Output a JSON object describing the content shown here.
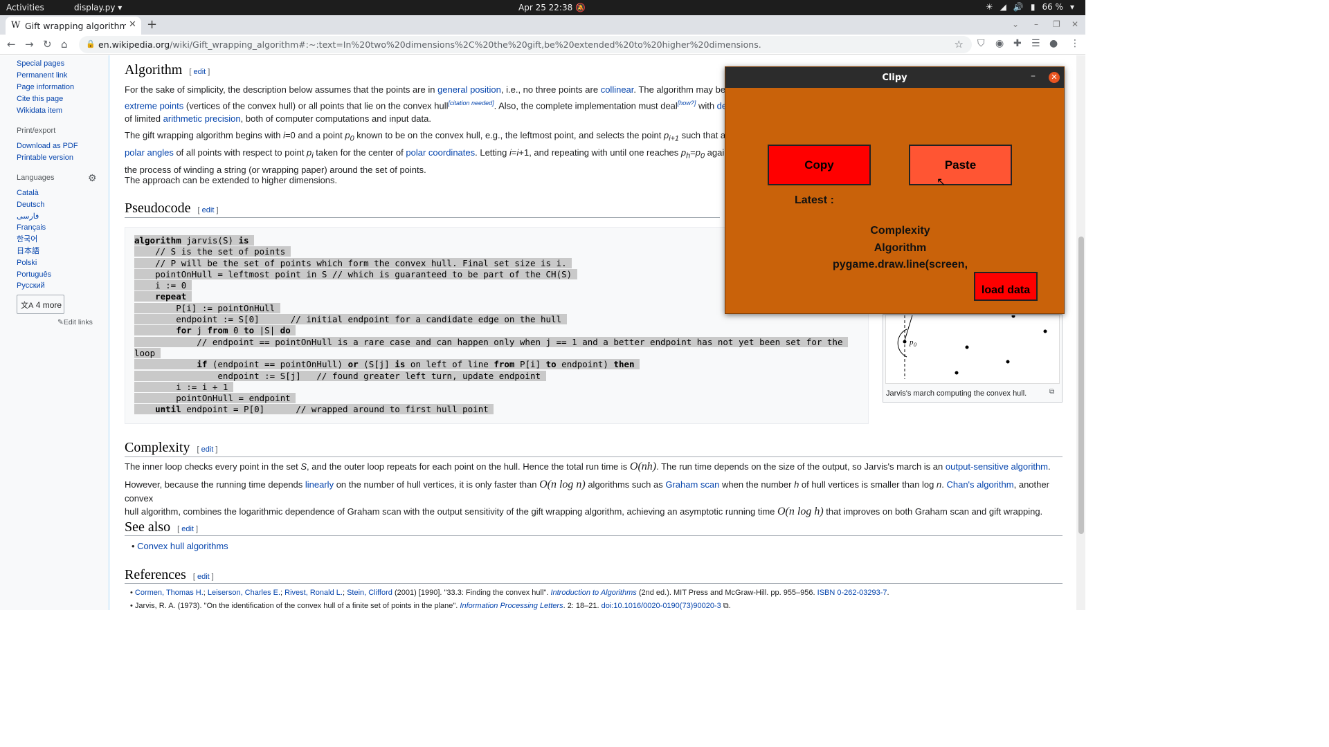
{
  "topbar": {
    "activities": "Activities",
    "app_menu": "display.py",
    "clock": "Apr 25  22:38",
    "battery": "66 %"
  },
  "browser": {
    "tab_title": "Gift wrapping algorithm",
    "url_host": "en.wikipedia.org",
    "url_path": "/wiki/Gift_wrapping_algorithm#:~:text=In%20two%20dimensions%2C%20the%20gift,be%20extended%20to%20higher%20dimensions."
  },
  "sidebar": {
    "tools": [
      "Special pages",
      "Permanent link",
      "Page information",
      "Cite this page",
      "Wikidata item"
    ],
    "print_heading": "Print/export",
    "print": [
      "Download as PDF",
      "Printable version"
    ],
    "languages_heading": "Languages",
    "languages": [
      "Català",
      "Deutsch",
      "فارسی",
      "Français",
      "한국어",
      "日本語",
      "Polski",
      "Português",
      "Русский"
    ],
    "more_languages": "4 more",
    "edit_links": "Edit links"
  },
  "article": {
    "edit_label": "edit",
    "algorithm": {
      "heading": "Algorithm",
      "p1_a": "For the sake of simplicity, the description below assumes that the points are in ",
      "p1_link1": "general position",
      "p1_b": ", i.e., no three points are ",
      "p1_link2": "collinear",
      "p1_c": ". The algorithm may be easi",
      "p1_link3": "extreme points",
      "p1_d": " (vertices of the convex hull) or all points that lie on the convex hull",
      "p1_sup1": "[citation needed]",
      "p1_e": ". Also, the complete implementation must deal",
      "p1_sup2": "[how?]",
      "p1_f": " with ",
      "p1_link4": "dege",
      "p1_g": "of limited ",
      "p1_link5": "arithmetic precision",
      "p1_h": ", both of computer computations and input data.",
      "p2_a": "The gift wrapping algorithm begins with ",
      "p2_b": "=0 and a point ",
      "p2_c": " known to be on the convex hull, e.g., the leftmost point, and selects the point ",
      "p2_d": " such that all poi",
      "p2_link1": "polar angles",
      "p2_e": " of all points with respect to point ",
      "p2_f": " taken for the center of ",
      "p2_link2": "polar coordinates",
      "p2_g": ". Letting ",
      "p2_h": "=",
      "p2_i": "+1, and repeating with until one reaches ",
      "p2_j": " again yiel",
      "p2_k": "the process of winding a string (or wrapping paper) around the set of points.",
      "p3": "The approach can be extended to higher dimensions."
    },
    "pseudocode": {
      "heading": "Pseudocode",
      "lines": [
        "algorithm jarvis(S) is",
        "    // S is the set of points",
        "    // P will be the set of points which form the convex hull. Final set size is i.",
        "    pointOnHull = leftmost point in S // which is guaranteed to be part of the CH(S)",
        "    i := 0",
        "    repeat",
        "        P[i] := pointOnHull",
        "        endpoint := S[0]      // initial endpoint for a candidate edge on the hull",
        "        for j from 0 to |S| do",
        "            // endpoint == pointOnHull is a rare case and can happen only when j == 1 and a better endpoint has not yet been set for the",
        "loop",
        "            if (endpoint == pointOnHull) or (S[j] is on left of line from P[i] to endpoint) then",
        "                endpoint := S[j]   // found greater left turn, update endpoint",
        "        i := i + 1",
        "        pointOnHull = endpoint",
        "    until endpoint = P[0]      // wrapped around to first hull point"
      ]
    },
    "figure_caption": "Jarvis's march computing the convex hull.",
    "complexity": {
      "heading": "Complexity",
      "p1_a": "The inner loop checks every point in the set ",
      "p1_b": ", and the outer loop repeats for each point on the hull. Hence the total run time is ",
      "p1_math": "O(nh)",
      "p1_c": ". The run time depends on the size of the output, so Jarvis's march is an ",
      "p1_link": "output-sensitive algorithm",
      "p1_d": ".",
      "p2_a": "However, because the running time depends ",
      "p2_link1": "linearly",
      "p2_b": " on the number of hull vertices, it is only faster than ",
      "p2_math1": "O(n log n)",
      "p2_c": " algorithms such as ",
      "p2_link2": "Graham scan",
      "p2_d": " when the number ",
      "p2_e": " of hull vertices is smaller than log ",
      "p2_f": ". ",
      "p2_link3": "Chan's algorithm",
      "p2_g": ", another convex",
      "p2_h": "hull algorithm, combines the logarithmic dependence of Graham scan with the output sensitivity of the gift wrapping algorithm, achieving an asymptotic running time ",
      "p2_math2": "O(n log h)",
      "p2_i": " that improves on both Graham scan and gift wrapping."
    },
    "see_also": {
      "heading": "See also",
      "items": [
        "Convex hull algorithms"
      ]
    },
    "references": {
      "heading": "References",
      "ref1_authors": [
        "Cormen, Thomas H.",
        "Leiserson, Charles E.",
        "Rivest, Ronald L.",
        "Stein, Clifford"
      ],
      "ref1_a": " (2001) [1990]. \"33.3: Finding the convex hull\". ",
      "ref1_book": "Introduction to Algorithms",
      "ref1_b": " (2nd ed.). MIT Press and McGraw-Hill. pp. 955–956. ",
      "ref1_isbn": "ISBN 0-262-03293-7",
      "ref1_c": ".",
      "ref2_a": "Jarvis, R. A. (1973). \"On the identification of the convex hull of a finite set of points in the plane\". ",
      "ref2_journal": "Information Processing Letters",
      "ref2_b": ". 2: 18–21. ",
      "ref2_doi": "doi:10.1016/0020-0190(73)90020-3"
    }
  },
  "clipy": {
    "title": "Clipy",
    "copy_label": "Copy",
    "paste_label": "Paste",
    "latest_label": "Latest :",
    "history": [
      "Complexity",
      "Algorithm",
      "pygame.draw.line(screen,"
    ],
    "load_label": "load data",
    "colors": {
      "background": "#c9620a",
      "copy": "#ff0000",
      "paste": "#ff5533",
      "load": "#ff0000"
    }
  }
}
